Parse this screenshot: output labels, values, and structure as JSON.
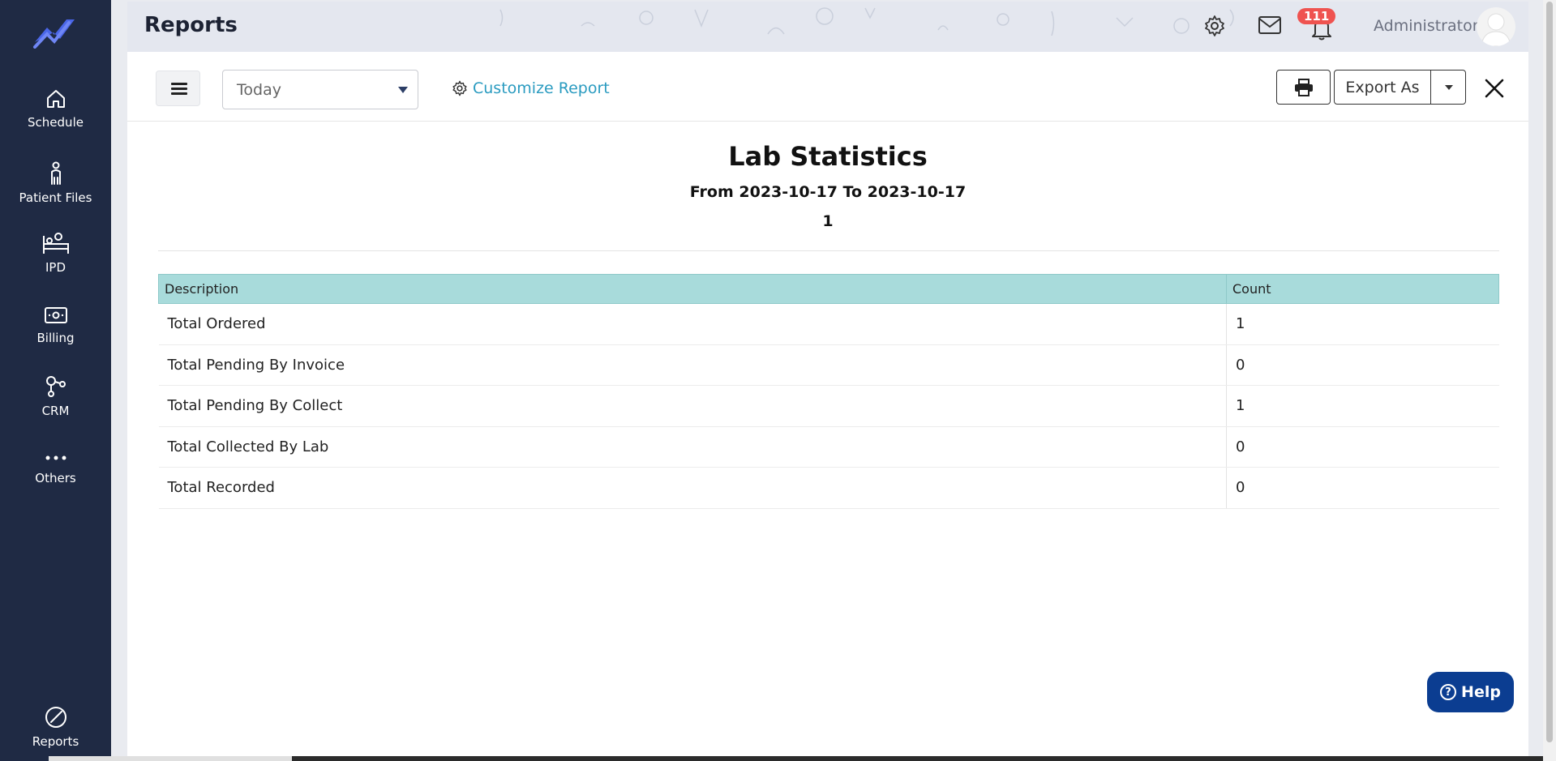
{
  "sidebar": {
    "logo_icon": "trend-line-logo",
    "items": [
      {
        "label": "Schedule",
        "icon": "home-icon"
      },
      {
        "label": "Patient Files",
        "icon": "person-icon"
      },
      {
        "label": "IPD",
        "icon": "bed-icon"
      },
      {
        "label": "Billing",
        "icon": "money-icon"
      },
      {
        "label": "CRM",
        "icon": "network-icon"
      },
      {
        "label": "Others",
        "icon": "dots-icon"
      },
      {
        "label": "Reports",
        "icon": "pie-icon"
      }
    ]
  },
  "header": {
    "title": "Reports",
    "notification_count": "111",
    "user_name": "Administrator",
    "icons": [
      "gear-icon",
      "mail-icon",
      "bell-icon"
    ]
  },
  "toolbar": {
    "date_filter": "Today",
    "customize_label": "Customize Report",
    "export_label": "Export As"
  },
  "report": {
    "title": "Lab Statistics",
    "range": "From 2023-10-17 To 2023-10-17",
    "number": "1",
    "columns": [
      "Description",
      "Count"
    ],
    "rows": [
      {
        "description": "Total Ordered",
        "count": "1"
      },
      {
        "description": "Total Pending By Invoice",
        "count": "0"
      },
      {
        "description": "Total Pending By Collect",
        "count": "1"
      },
      {
        "description": "Total Collected By Lab",
        "count": "0"
      },
      {
        "description": "Total Recorded",
        "count": "0"
      }
    ]
  },
  "help": {
    "label": "Help"
  },
  "colors": {
    "sidebar_bg": "#1f2a44",
    "accent_link": "#2a9bc0",
    "table_header": "#a8dbdb",
    "help_bg": "#0b3d91",
    "badge": "#ef5350"
  }
}
